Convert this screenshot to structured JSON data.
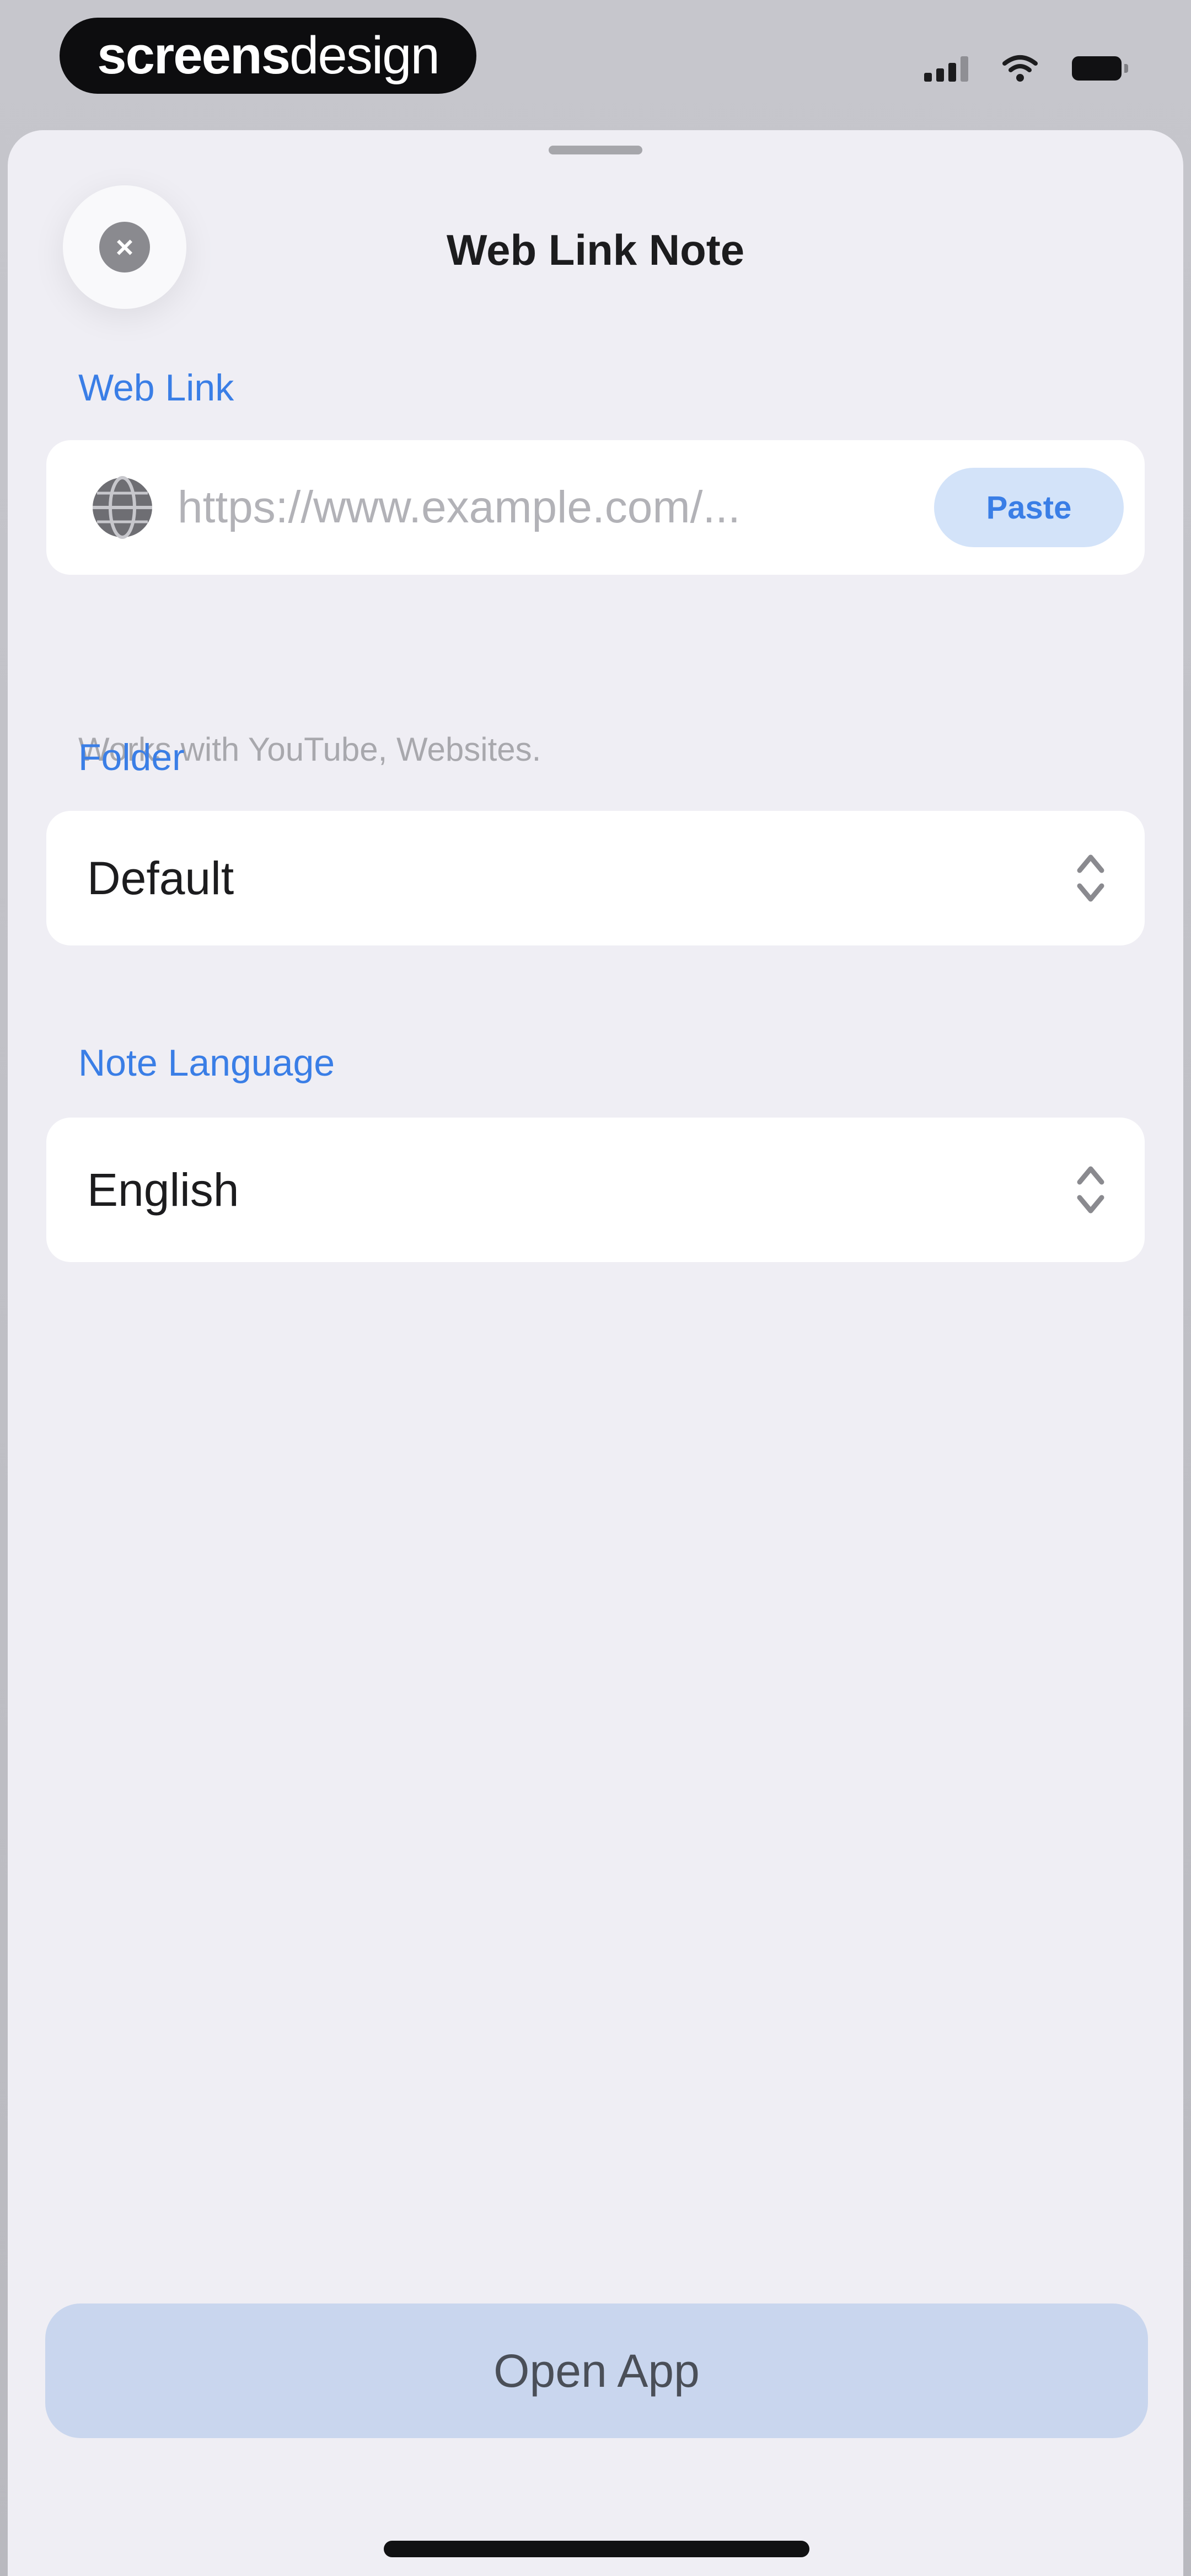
{
  "status_bar": {
    "brand_strong": "screens",
    "brand_light": "design",
    "icons": [
      "cellular-signal-icon",
      "wifi-icon",
      "battery-icon"
    ]
  },
  "sheet": {
    "title": "Web Link Note",
    "close_icon": "close-icon",
    "web_link": {
      "label": "Web Link",
      "icon": "globe-icon",
      "value": "",
      "placeholder": "https://www.example.com/...",
      "paste_label": "Paste",
      "helper": "Works with YouTube, Websites."
    },
    "folder": {
      "label": "Folder",
      "value": "Default",
      "icon": "chevron-up-down-icon"
    },
    "note_language": {
      "label": "Note Language",
      "value": "English",
      "icon": "chevron-up-down-icon"
    },
    "open_app_label": "Open App"
  },
  "colors": {
    "accent": "#3a7ee6",
    "sheet_background": "#efeef4",
    "paste_background": "#d3e3f9",
    "open_app_background": "#c9d6ee"
  }
}
